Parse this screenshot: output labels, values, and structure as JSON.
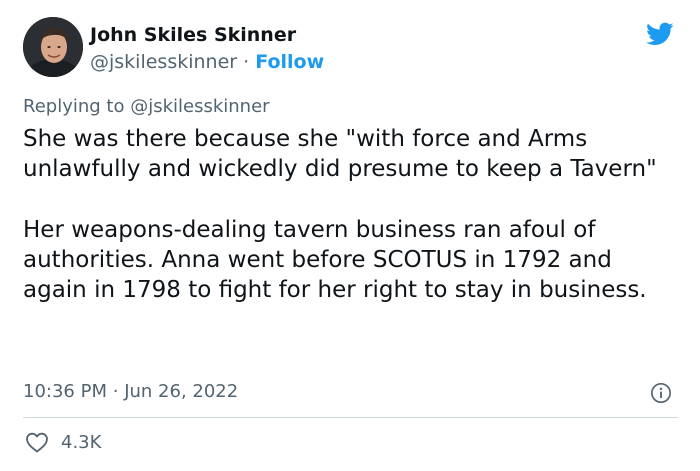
{
  "author": {
    "name": "John Skiles Skinner",
    "handle": "@jskilesskinner",
    "separator": "·",
    "follow_label": "Follow"
  },
  "reply": {
    "prefix": "Replying to",
    "mention": "@jskilesskinner"
  },
  "tweet": {
    "paragraph_1": "She was there because she \"with force and Arms unlawfully and wickedly did presume to keep a Tavern\"",
    "paragraph_2": "Her weapons-dealing tavern business ran afoul of authorities. Anna went before SCOTUS in 1792 and again in 1798 to fight for her right to stay in business."
  },
  "meta": {
    "time": "10:36 PM",
    "separator": "·",
    "date": "Jun 26, 2022"
  },
  "engagement": {
    "likes": "4.3K"
  },
  "colors": {
    "twitter_blue": "#1d9bf0",
    "secondary_text": "#536471",
    "divider": "#cfd9de"
  },
  "icons": [
    "twitter-bird-icon",
    "info-icon",
    "heart-icon"
  ]
}
